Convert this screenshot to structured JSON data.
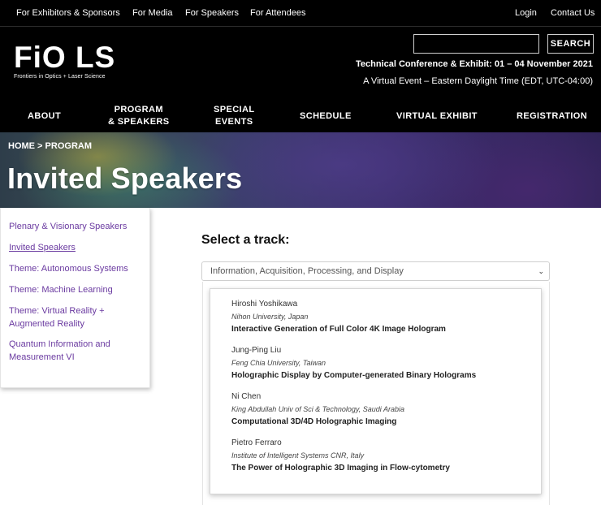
{
  "topbar": {
    "links": [
      "For Exhibitors & Sponsors",
      "For Media",
      "For Speakers",
      "For Attendees"
    ],
    "login": "Login",
    "contact": "Contact Us"
  },
  "logo": {
    "wordmark": "FiO LS",
    "tagline": "Frontiers in Optics + Laser Science"
  },
  "search": {
    "value": "",
    "button_label": "SEARCH"
  },
  "event": {
    "line1": "Technical Conference & Exhibit:  01 – 04 November 2021",
    "line2": "A Virtual Event – Eastern Daylight Time (EDT, UTC-04:00)"
  },
  "nav": {
    "about": "ABOUT",
    "program_line1": "PROGRAM",
    "program_line2": "& SPEAKERS",
    "special_line1": "SPECIAL",
    "special_line2": "EVENTS",
    "schedule": "SCHEDULE",
    "virtual_exhibit": "VIRTUAL EXHIBIT",
    "registration": "REGISTRATION"
  },
  "breadcrumb": {
    "home": "HOME",
    "separator": " > ",
    "program": "PROGRAM"
  },
  "page_title": "Invited Speakers",
  "sidebar": {
    "items": [
      {
        "label": "Plenary & Visionary Speakers"
      },
      {
        "label": "Invited Speakers"
      },
      {
        "label": "Theme: Autonomous Systems"
      },
      {
        "label": "Theme: Machine Learning"
      },
      {
        "label": "Theme: Virtual Reality + Augmented Reality"
      },
      {
        "label": "Quantum Information and Measurement VI"
      }
    ]
  },
  "track": {
    "heading": "Select a track:",
    "selected": "Information, Acquisition, Processing, and Display"
  },
  "speakers": [
    {
      "name": "Hiroshi Yoshikawa",
      "affiliation": "Nihon University, Japan",
      "talk": "Interactive Generation of Full Color 4K Image Hologram"
    },
    {
      "name": "Jung-Ping Liu",
      "affiliation": "Feng Chia University, Taiwan",
      "talk": "Holographic Display by Computer-generated Binary Holograms"
    },
    {
      "name": "Ni Chen",
      "affiliation": "King Abdullah Univ of Sci & Technology, Saudi Arabia",
      "talk": "Computational 3D/4D Holographic Imaging"
    },
    {
      "name": "Pietro Ferraro",
      "affiliation": "Institute of Intelligent Systems CNR, Italy",
      "talk": "The Power of Holographic 3D Imaging in Flow-cytometry"
    }
  ],
  "colors": {
    "header_bg": "#000000",
    "sidebar_link": "#6a3aa0"
  }
}
